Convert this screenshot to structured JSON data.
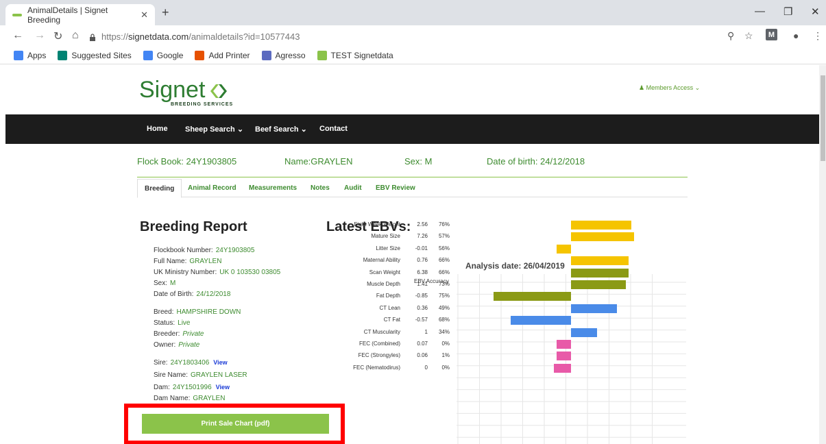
{
  "browser": {
    "tab_title": "AnimalDetails | Signet Breeding",
    "url_prefix": "https://",
    "url_host": "signetdata.com",
    "url_path": "/animaldetails?id=10577443",
    "profile_badge": "M",
    "bookmarks": [
      {
        "label": "Apps",
        "icon": "apps-icon",
        "color": "#4285f4"
      },
      {
        "label": "Suggested Sites",
        "icon": "bing-icon",
        "color": "#008373"
      },
      {
        "label": "Google",
        "icon": "google-icon",
        "color": "#4285f4"
      },
      {
        "label": "Add Printer",
        "icon": "printer-icon",
        "color": "#e65100"
      },
      {
        "label": "Agresso",
        "icon": "agresso-icon",
        "color": "#5c6bc0"
      },
      {
        "label": "TEST Signetdata",
        "icon": "signet-icon",
        "color": "#8bc34a"
      }
    ]
  },
  "site": {
    "logo_word": "Signet",
    "logo_sub": "BREEDING SERVICES",
    "members_access": "Members Access",
    "nav": [
      "Home",
      "Sheep Search",
      "Beef Search",
      "Contact"
    ]
  },
  "animal": {
    "flock_book": "Flock Book: 24Y1903805",
    "name": "Name:GRAYLEN",
    "sex": "Sex: M",
    "dob": "Date of birth: 24/12/2018"
  },
  "tabs": [
    "Breeding",
    "Animal Record",
    "Measurements",
    "Notes",
    "Audit",
    "EBV Review"
  ],
  "report": {
    "title": "Breeding Report",
    "ebv_title": "Latest EBVs:",
    "fields": [
      {
        "label": "Flockbook Number:",
        "value": "24Y1903805"
      },
      {
        "label": "Full Name:",
        "value": "GRAYLEN"
      },
      {
        "label": "UK Ministry Number:",
        "value": "UK 0 103530 03805"
      },
      {
        "label": "Sex:",
        "value": "M"
      },
      {
        "label": "Date of Birth:",
        "value": "24/12/2018"
      },
      {
        "label": "Breed:",
        "value": "HAMPSHIRE DOWN"
      },
      {
        "label": "Status:",
        "value": "Live"
      },
      {
        "label": "Breeder:",
        "value": "Private"
      },
      {
        "label": "Owner:",
        "value": "Private"
      },
      {
        "label": "Sire:",
        "value": "24Y1803406",
        "link": "View"
      },
      {
        "label": "Sire Name:",
        "value": "GRAYLEN LASER"
      },
      {
        "label": "Dam:",
        "value": "24Y1501996",
        "link": "View"
      },
      {
        "label": "Dam Name:",
        "value": "GRAYLEN"
      }
    ],
    "print_button": "Print Sale Chart (pdf)"
  },
  "chart_data": {
    "type": "bar",
    "title": "Analysis date: 26/04/2019",
    "column_headers": [
      "EBV",
      "Accuracy"
    ],
    "categories": [
      "Eight Week Weight",
      "Mature Size",
      "Litter Size",
      "Maternal Ability",
      "Scan Weight",
      "Muscle Depth",
      "Fat Depth",
      "CT Lean",
      "CT Fat",
      "CT Muscularity",
      "FEC (Combined)",
      "FEC (Strongyles)",
      "FEC (Nematodirus)"
    ],
    "values": [
      2.56,
      7.26,
      -0.01,
      0.76,
      6.38,
      1.41,
      -0.85,
      0.36,
      -0.57,
      1,
      0.07,
      0.06,
      0
    ],
    "value_labels": [
      "2.56",
      "7.26",
      "-0.01",
      "0.76",
      "6.38",
      "1.41",
      "-0.85",
      "0.36",
      "-0.57",
      "1",
      "0.07",
      "0.06",
      "0"
    ],
    "accuracy": [
      "76%",
      "57%",
      "56%",
      "66%",
      "66%",
      "73%",
      "75%",
      "49%",
      "68%",
      "34%",
      "0%",
      "1%",
      "0%"
    ],
    "bar_offsets": [
      2.1,
      2.2,
      -0.5,
      2.0,
      2.0,
      1.9,
      -2.7,
      1.6,
      -2.1,
      0.9,
      -0.5,
      -0.5,
      -0.6
    ],
    "bar_colors": [
      "#f5c400",
      "#f5c400",
      "#f5c400",
      "#f5c400",
      "#8b9a15",
      "#8b9a15",
      "#8b9a15",
      "#4a8be8",
      "#4a8be8",
      "#4a8be8",
      "#e85aa8",
      "#e85aa8",
      "#e85aa8"
    ]
  }
}
